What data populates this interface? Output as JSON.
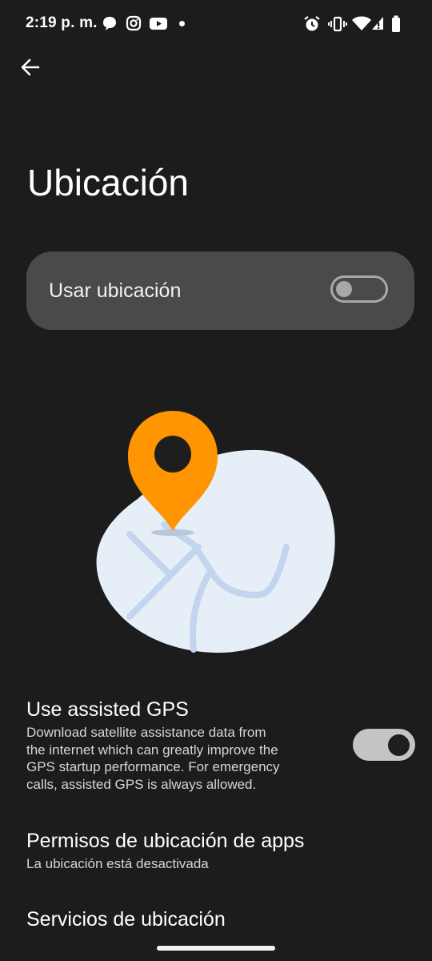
{
  "status_bar": {
    "time": "2:19 p. m.",
    "left_icons": [
      "chat-bubble-icon",
      "instagram-icon",
      "youtube-icon",
      "notification-dot-icon"
    ],
    "right_icons": [
      "alarm-icon",
      "vibrate-icon",
      "wifi-icon",
      "signal-icon",
      "battery-icon"
    ]
  },
  "header": {
    "back_icon": "arrow-left-icon",
    "title": "Ubicación"
  },
  "main_toggle": {
    "label": "Usar ubicación",
    "checked": false
  },
  "illustration": {
    "icon": "location-map-illustration",
    "colors": {
      "pin": "#ff9500",
      "map": "#e6eef8",
      "roads": "#c2d4ee"
    }
  },
  "settings": {
    "assisted_gps": {
      "title": "Use assisted GPS",
      "summary_lines": [
        "Download satellite assistance data from",
        "the internet which can greatly improve the",
        "GPS startup performance. For emergency",
        "calls, assisted GPS is always allowed."
      ],
      "checked": true
    },
    "app_permissions": {
      "title": "Permisos de ubicación de apps",
      "summary": "La ubicación está desactivada"
    },
    "location_services": {
      "title": "Servicios de ubicación"
    }
  },
  "colors": {
    "background": "#1c1c1c",
    "card": "#4a4a4a",
    "accent": "#ff9500"
  }
}
